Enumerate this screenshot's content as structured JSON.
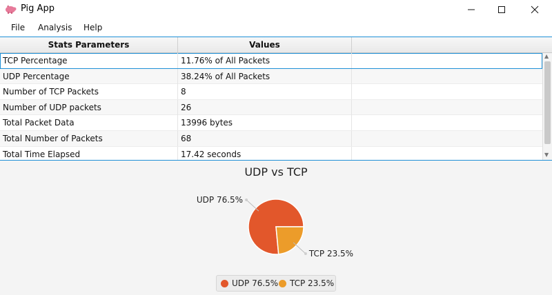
{
  "window": {
    "title": "Pig App",
    "icon": "pig-icon",
    "controls": [
      "minimize-icon",
      "maximize-icon",
      "close-icon"
    ]
  },
  "menu": {
    "items": [
      {
        "label": "File"
      },
      {
        "label": "Analysis"
      },
      {
        "label": "Help"
      }
    ]
  },
  "table": {
    "headers": [
      "Stats Parameters",
      "Values"
    ],
    "rows": [
      {
        "param": "TCP Percentage",
        "value": "11.76% of All Packets"
      },
      {
        "param": "UDP Percentage",
        "value": "38.24% of All Packets"
      },
      {
        "param": "Number of TCP Packets",
        "value": "8"
      },
      {
        "param": "Number of UDP packets",
        "value": "26"
      },
      {
        "param": "Total Packet Data",
        "value": "13996 bytes"
      },
      {
        "param": "Total Number of Packets",
        "value": "68"
      },
      {
        "param": "Total Time Elapsed",
        "value": "17.42 seconds"
      }
    ],
    "selected_row": 0
  },
  "chart_data": {
    "type": "pie",
    "title": "UDP vs TCP",
    "slices": [
      {
        "label": "UDP 76.5%",
        "value": 76.5,
        "color": "#e2572b"
      },
      {
        "label": "TCP 23.5%",
        "value": 23.5,
        "color": "#ec9c2a"
      }
    ],
    "legend": "bottom-center"
  }
}
